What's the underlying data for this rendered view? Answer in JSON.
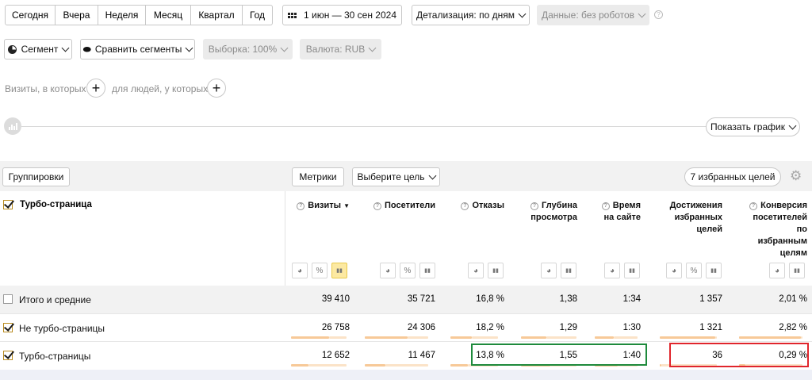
{
  "period_tabs": [
    "Сегодня",
    "Вчера",
    "Неделя",
    "Месяц",
    "Квартал",
    "Год"
  ],
  "date_range": "1 июн — 30 сен 2024",
  "detail": "Детализация: по дням",
  "data_filter": "Данные: без роботов",
  "segment": "Сегмент",
  "compare_segments": "Сравнить сегменты",
  "sample": "Выборка: 100%",
  "currency": "Валюта: RUB",
  "visits_filter": "Визиты, в которых",
  "people_filter": "для людей, у которых",
  "show_chart": "Показать график",
  "groupings": "Группировки",
  "metrics": "Метрики",
  "choose_goal": "Выберите цель",
  "favorite_goals": "7 избранных целей",
  "dimension_header": "Турбо-страница",
  "columns": [
    "Визиты",
    "Посетители",
    "Отказы",
    "Глубина просмотра",
    "Время на сайте",
    "Достижения избранных целей",
    "Конверсия посетителей по избранным целям"
  ],
  "sort_marker": "▼",
  "rows": [
    {
      "label": "Итого и средние",
      "checked": false,
      "values": [
        "39 410",
        "35 721",
        "16,8 %",
        "1,38",
        "1:34",
        "1 357",
        "2,01 %"
      ]
    },
    {
      "label": "Не турбо-страницы",
      "checked": true,
      "values": [
        "26 758",
        "24 306",
        "18,2 %",
        "1,29",
        "1:30",
        "1 321",
        "2,82 %"
      ],
      "bars": [
        0.68,
        0.68,
        0.45,
        0.45,
        0.45,
        0.97,
        0.97
      ]
    },
    {
      "label": "Турбо-страницы",
      "checked": true,
      "values": [
        "12 652",
        "11 467",
        "13,8 %",
        "1,55",
        "1:40",
        "36",
        "0,29 %"
      ],
      "bars": [
        0.32,
        0.32,
        0.36,
        0.53,
        0.53,
        0.03,
        0.1
      ]
    }
  ],
  "colors": {
    "accent": "#fce9a2",
    "bar": "#f7c998",
    "green_box": "#1e8a3c",
    "red_box": "#e0252c"
  }
}
